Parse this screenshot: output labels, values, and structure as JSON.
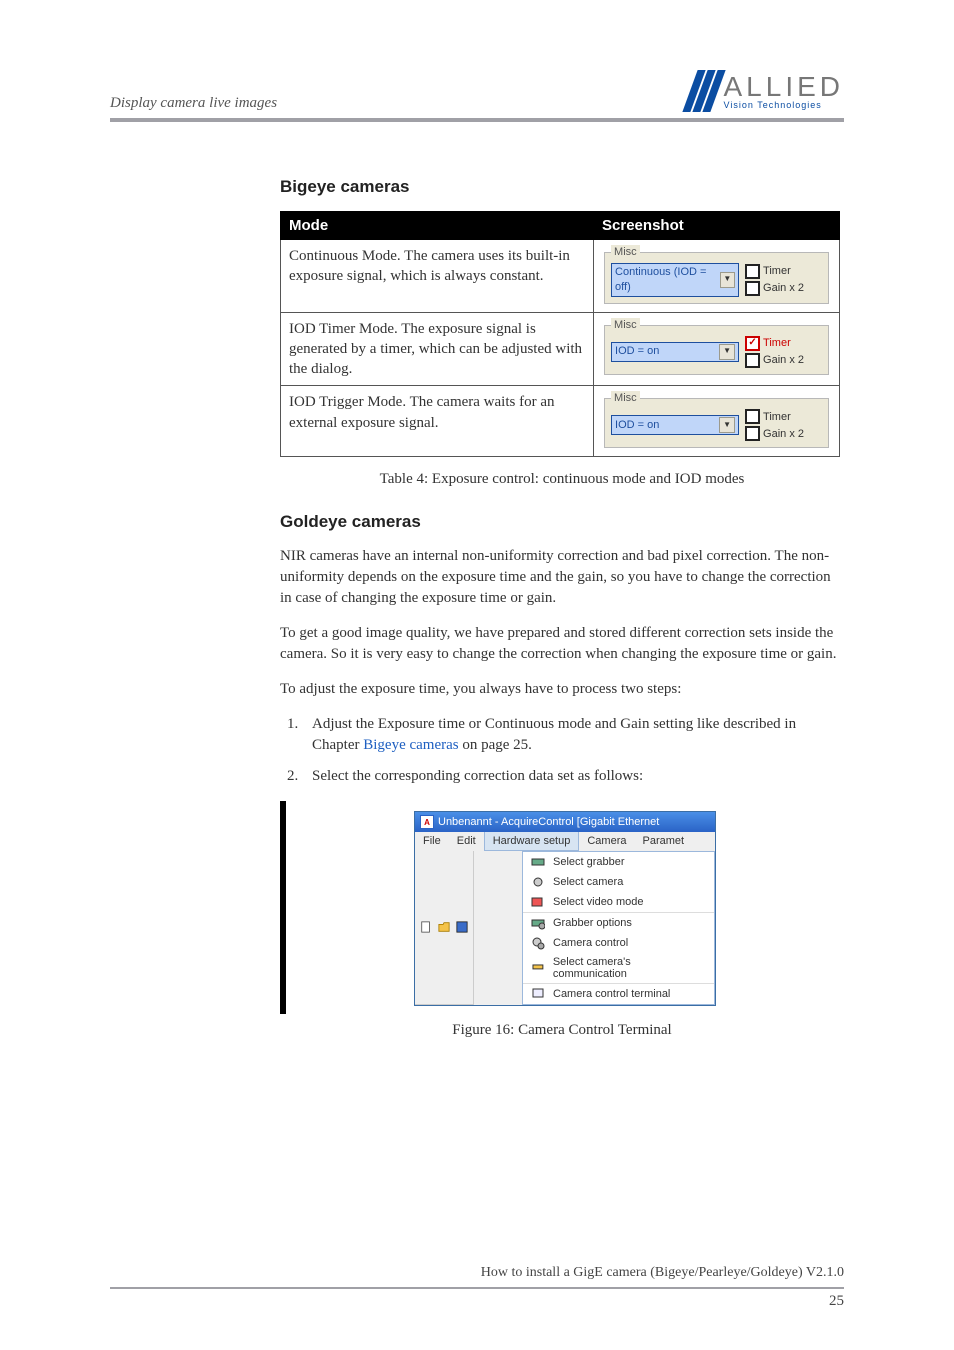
{
  "header": {
    "left": "Display camera live images",
    "logo_main": "ALLIED",
    "logo_sub": "Vision Technologies"
  },
  "sections": {
    "bigeye_title": "Bigeye cameras",
    "goldeye_title": "Goldeye cameras"
  },
  "table": {
    "headers": {
      "mode": "Mode",
      "screenshot": "Screenshot"
    },
    "rows": {
      "r1": {
        "desc": "Continuous Mode. The camera uses its built-in exposure signal, which is always constant.",
        "dd": "Continuous (IOD = off)",
        "chk1": "Timer",
        "chk2": "Gain x 2",
        "legend": "Misc"
      },
      "r2": {
        "desc": "IOD Timer Mode. The exposure signal is generated by a timer, which can be adjusted with the dialog.",
        "dd": "IOD = on",
        "chk1": "Timer",
        "chk2": "Gain x 2",
        "legend": "Misc"
      },
      "r3": {
        "desc": "IOD Trigger Mode. The camera waits for an external exposure signal.",
        "dd": "IOD = on",
        "chk1": "Timer",
        "chk2": "Gain x 2",
        "legend": "Misc"
      }
    },
    "caption": "Table 4: Exposure control: continuous mode and IOD modes"
  },
  "body": {
    "p1": "NIR cameras have an internal non-uniformity correction and bad pixel correction. The non-uniformity depends on the exposure time and the gain, so you have to change the correction in case of changing the exposure time or gain.",
    "p2": "To get a good image quality, we have prepared and stored different correction sets inside the camera. So it is very easy to change the correction when changing the exposure time or gain.",
    "p3": "To adjust the exposure time, you always have to process two steps:",
    "step1a": "Adjust the Exposure time or Continuous mode and Gain setting like described in Chapter ",
    "step1link": "Bigeye cameras",
    "step1b": " on page 25.",
    "step2": "Select the corresponding correction data set as follows:"
  },
  "fig16": {
    "title": "Unbenannt - AcquireControl [Gigabit Ethernet",
    "menus": {
      "file": "File",
      "edit": "Edit",
      "hw": "Hardware setup",
      "camera": "Camera",
      "param": "Paramet"
    },
    "items": {
      "m1": "Select grabber",
      "m2": "Select camera",
      "m3": "Select video mode",
      "m4": "Grabber options",
      "m5": "Camera control",
      "m6": "Select camera's communication",
      "m7": "Camera control terminal"
    },
    "caption": "Figure 16: Camera Control Terminal"
  },
  "footer": {
    "text": "How to install a GigE camera (Bigeye/Pearleye/Goldeye) V2.1.0",
    "page": "25"
  }
}
